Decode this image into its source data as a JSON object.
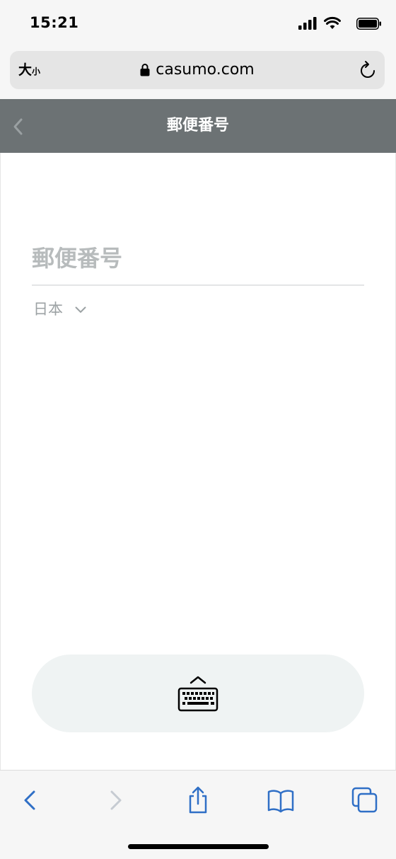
{
  "status_bar": {
    "time": "15:21",
    "icons": [
      "signal-icon",
      "wifi-icon",
      "battery-icon"
    ]
  },
  "browser": {
    "text_size_label_large": "大",
    "text_size_label_small": "小",
    "url": "casumo.com",
    "icons": [
      "lock-icon",
      "reload-icon"
    ]
  },
  "header": {
    "title": "郵便番号",
    "background_color": "#6c7274"
  },
  "form": {
    "postal_code": {
      "placeholder": "郵便番号",
      "value": ""
    },
    "country": {
      "selected": "日本"
    }
  },
  "keyboard_toggle": {
    "icon": "keyboard-icon"
  },
  "toolbar": {
    "items": [
      "back-icon",
      "forward-icon",
      "share-icon",
      "bookmarks-icon",
      "tabs-icon"
    ],
    "accent_color": "#2f6fc6"
  }
}
